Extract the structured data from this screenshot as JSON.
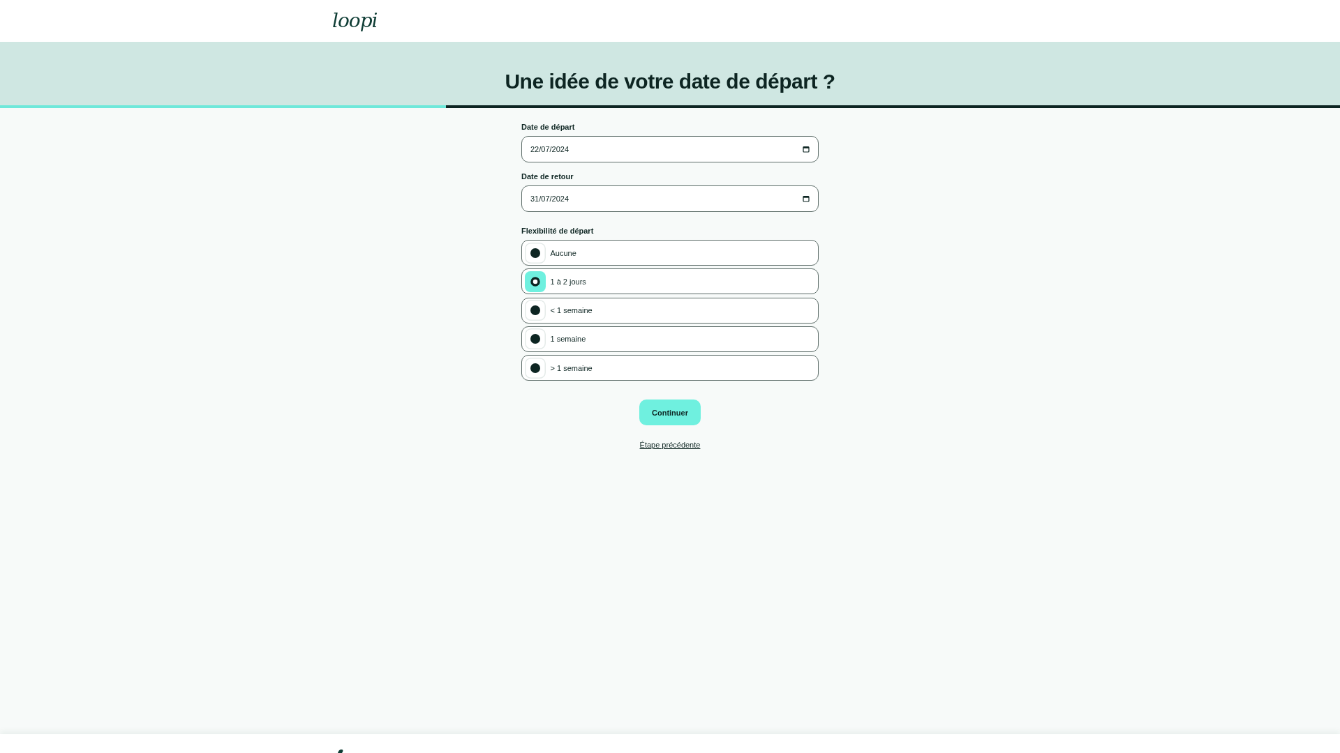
{
  "header": {
    "logo": "loopi"
  },
  "title_band": {
    "title": "Une idée de votre date de départ ?",
    "progress": {
      "level": 0.333
    }
  },
  "form": {
    "date_fields": [
      {
        "label": "Date de départ",
        "value": "22/07/2024"
      },
      {
        "label": "Date de retour",
        "value": "31/07/2024"
      }
    ],
    "flexibility": {
      "label": "Flexibilité de départ",
      "options": [
        {
          "label": "Aucune",
          "selected": false
        },
        {
          "label": "1 à 2 jours",
          "selected": true
        },
        {
          "label": "< 1 semaine",
          "selected": false
        },
        {
          "label": "1 semaine",
          "selected": false
        },
        {
          "label": "> 1 semaine",
          "selected": false
        }
      ]
    },
    "submit_button": "Continuer",
    "back_link": "Étape précédente"
  }
}
